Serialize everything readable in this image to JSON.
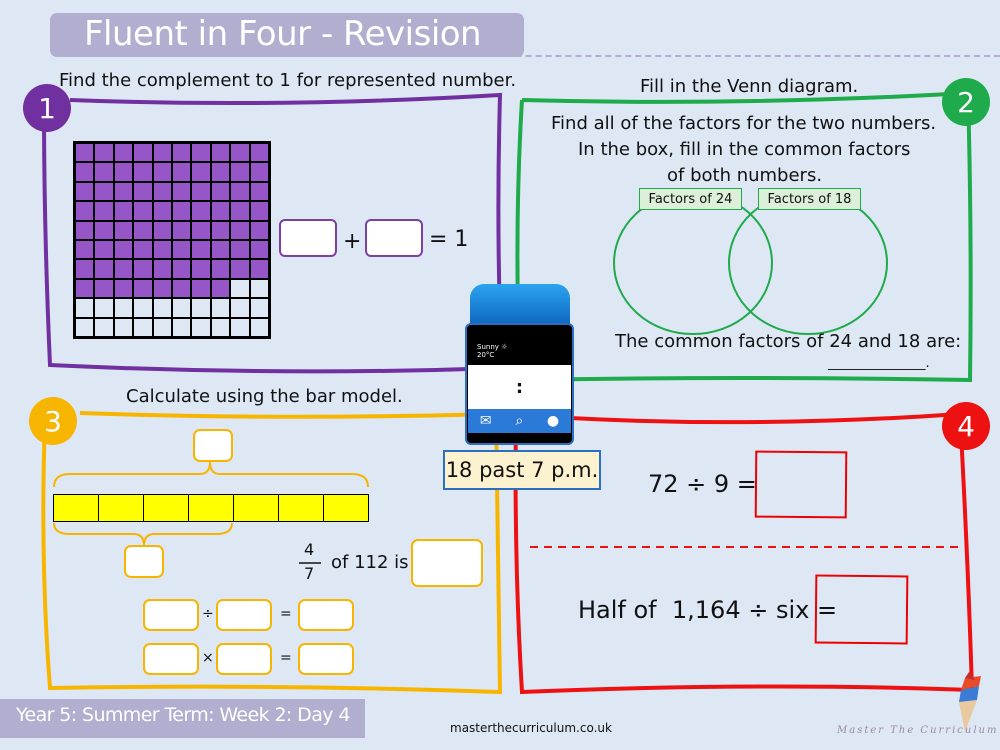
{
  "header": {
    "title": "Fluent in Four - Revision"
  },
  "colors": {
    "q1": "#7030a0",
    "q2": "#1faa4b",
    "q3": "#f7b500",
    "q4": "#ee1111",
    "grid_fill": "#9656c8",
    "bar_fill": "#ffff00",
    "title_bg": "#b1aed0"
  },
  "q1": {
    "number": "1",
    "instruction": "Find the complement to 1 for represented number.",
    "grid": {
      "rows": 10,
      "cols": 10,
      "shaded": 78
    },
    "plus": "+",
    "equals_one": "= 1"
  },
  "q2": {
    "number": "2",
    "instruction": "Fill in the Venn diagram.",
    "lines": [
      "Find all of the factors for the two numbers.",
      "In the box, fill in the common factors",
      "of both numbers."
    ],
    "venn_left_label": "Factors of 24",
    "venn_right_label": "Factors of 18",
    "common_text": "The common factors of 24 and 18 are:",
    "answer_line": "_______________."
  },
  "q3": {
    "number": "3",
    "instruction": "Calculate using the bar model.",
    "bar_parts": 7,
    "bracket_parts": 4,
    "fraction_num": "4",
    "fraction_den": "7",
    "fraction_text": "of 112 is",
    "divide": "÷",
    "times": "×",
    "equals": "="
  },
  "watch": {
    "weather": "Sunny",
    "temp": "20°C",
    "time_display": ":",
    "time_label": "18 past 7 p.m.",
    "icons": [
      "mail-icon",
      "search-icon",
      "user-icon"
    ]
  },
  "q4": {
    "number": "4",
    "eq1": "72 ÷ 9 =",
    "eq2": "Half of  1,164 ÷ six ="
  },
  "footer": {
    "term": "Year 5: Summer Term: Week 2: Day 4",
    "site": "masterthecurriculum.co.uk",
    "brand": "Master The Curriculum"
  }
}
